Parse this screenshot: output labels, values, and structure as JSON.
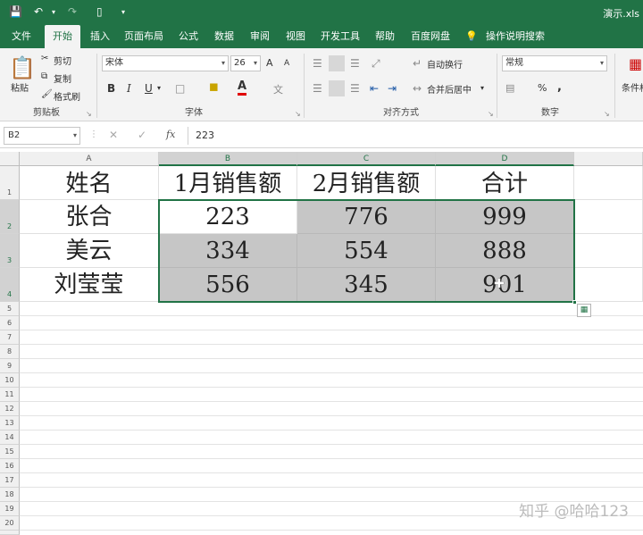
{
  "app": {
    "title": "演示.xls"
  },
  "quick_access": {
    "save_icon": "save-icon",
    "undo_icon": "undo-icon",
    "redo_icon": "redo-icon",
    "touch_icon": "touch-mode-icon",
    "customize_icon": "customize-icon"
  },
  "tabs": [
    "文件",
    "开始",
    "插入",
    "页面布局",
    "公式",
    "数据",
    "审阅",
    "视图",
    "开发工具",
    "帮助",
    "百度网盘",
    "操作说明搜索"
  ],
  "active_tab": "开始",
  "ribbon": {
    "clipboard": {
      "paste": "粘贴",
      "cut": "剪切",
      "copy": "复制",
      "format_painter": "格式刷",
      "label": "剪贴板"
    },
    "font": {
      "font_name": "宋体",
      "font_size": "26",
      "bold": "B",
      "italic": "I",
      "underline": "U",
      "font_color": "A",
      "grow": "A",
      "shrink": "A",
      "label": "字体"
    },
    "alignment": {
      "wrap_text": "自动换行",
      "merge_center": "合并后居中",
      "label": "对齐方式"
    },
    "number": {
      "format": "常规",
      "percent": "%",
      "comma": ",",
      "label": "数字"
    },
    "styles": {
      "conditional": "条件格"
    }
  },
  "formula_bar": {
    "name_box": "B2",
    "fx": "fx",
    "value": "223"
  },
  "columns": [
    "A",
    "B",
    "C",
    "D"
  ],
  "rows": [
    "1",
    "2",
    "3",
    "4",
    "5",
    "6",
    "7",
    "8",
    "9",
    "10",
    "11",
    "12",
    "13",
    "14",
    "15",
    "16",
    "17",
    "18",
    "19",
    "20",
    "21"
  ],
  "table": {
    "headers": [
      "姓名",
      "1月销售额",
      "2月销售额",
      "合计"
    ],
    "rows": [
      [
        "张合",
        "223",
        "776",
        "999"
      ],
      [
        "美云",
        "334",
        "554",
        "888"
      ],
      [
        "刘莹莹",
        "556",
        "345",
        "901"
      ]
    ]
  },
  "colors": {
    "accent": "#217346",
    "selection_fill": "#c6c6c6"
  },
  "watermark": "知乎 @哈哈123"
}
